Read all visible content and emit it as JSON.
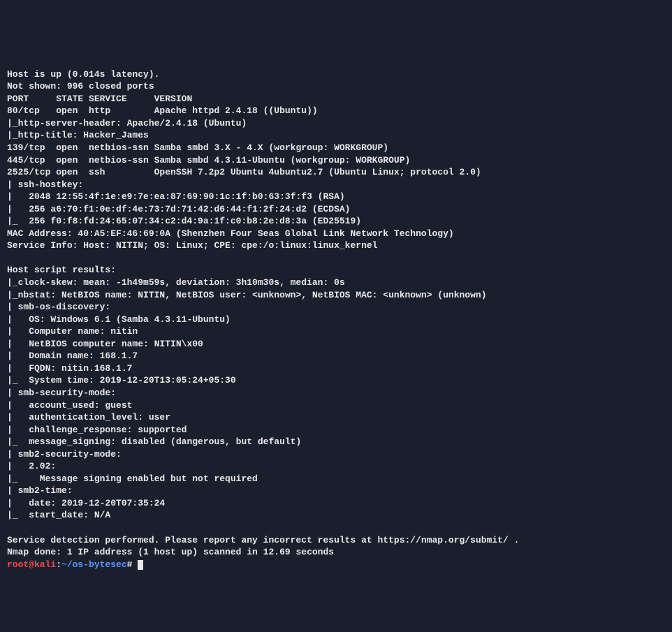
{
  "scan": {
    "host_up": "Host is up (0.014s latency).",
    "not_shown": "Not shown: 996 closed ports",
    "header": "PORT     STATE SERVICE     VERSION",
    "port80": "80/tcp   open  http        Apache httpd 2.4.18 ((Ubuntu))",
    "http_server_header": "|_http-server-header: Apache/2.4.18 (Ubuntu)",
    "http_title": "|_http-title: Hacker_James",
    "port139": "139/tcp  open  netbios-ssn Samba smbd 3.X - 4.X (workgroup: WORKGROUP)",
    "port445": "445/tcp  open  netbios-ssn Samba smbd 4.3.11-Ubuntu (workgroup: WORKGROUP)",
    "port2525": "2525/tcp open  ssh         OpenSSH 7.2p2 Ubuntu 4ubuntu2.7 (Ubuntu Linux; protocol 2.0)",
    "ssh_hostkey": "| ssh-hostkey:",
    "rsa_key": "|   2048 12:55:4f:1e:e9:7e:ea:87:69:90:1c:1f:b0:63:3f:f3 (RSA)",
    "ecdsa_key": "|   256 a6:70:f1:0e:df:4e:73:7d:71:42:d6:44:f1:2f:24:d2 (ECDSA)",
    "ed25519_key": "|_  256 f0:f8:fd:24:65:07:34:c2:d4:9a:1f:c0:b8:2e:d8:3a (ED25519)",
    "mac_address": "MAC Address: 40:A5:EF:46:69:0A (Shenzhen Four Seas Global Link Network Technology)",
    "service_info": "Service Info: Host: NITIN; OS: Linux; CPE: cpe:/o:linux:linux_kernel",
    "blank1": "",
    "host_script_header": "Host script results:",
    "clock_skew": "|_clock-skew: mean: -1h49m59s, deviation: 3h10m30s, median: 0s",
    "nbstat": "|_nbstat: NetBIOS name: NITIN, NetBIOS user: <unknown>, NetBIOS MAC: <unknown> (unknown)",
    "smb_os_discovery": "| smb-os-discovery:",
    "os_line": "|   OS: Windows 6.1 (Samba 4.3.11-Ubuntu)",
    "computer_name": "|   Computer name: nitin",
    "netbios_name": "|   NetBIOS computer name: NITIN\\x00",
    "domain_name": "|   Domain name: 168.1.7",
    "fqdn": "|   FQDN: nitin.168.1.7",
    "system_time": "|_  System time: 2019-12-20T13:05:24+05:30",
    "smb_security_mode": "| smb-security-mode:",
    "account_used": "|   account_used: guest",
    "auth_level": "|   authentication_level: user",
    "challenge_response": "|   challenge_response: supported",
    "message_signing": "|_  message_signing: disabled (dangerous, but default)",
    "smb2_security_mode": "| smb2-security-mode:",
    "smb2_version": "|   2.02:",
    "smb2_msg_signing": "|_    Message signing enabled but not required",
    "smb2_time": "| smb2-time:",
    "smb2_date": "|   date: 2019-12-20T07:35:24",
    "smb2_start_date": "|_  start_date: N/A",
    "blank2": "",
    "service_detection": "Service detection performed. Please report any incorrect results at https://nmap.org/submit/ .",
    "nmap_done": "Nmap done: 1 IP address (1 host up) scanned in 12.69 seconds"
  },
  "prompt": {
    "user_host": "root@kali",
    "separator": ":",
    "path": "~/os-bytesec",
    "end": "# "
  }
}
